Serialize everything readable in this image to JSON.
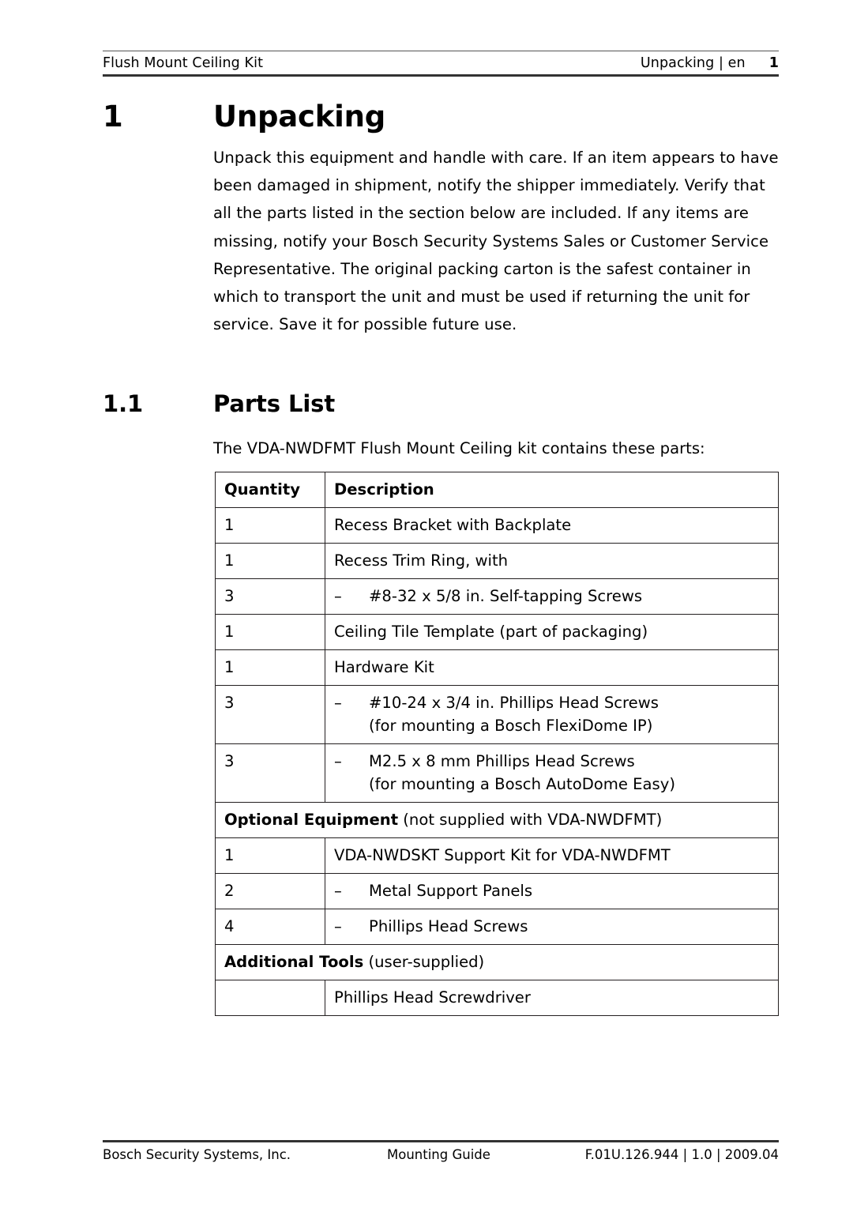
{
  "header": {
    "left": "Flush Mount Ceiling Kit",
    "chapter": "Unpacking | en",
    "page_number": "1"
  },
  "chapter": {
    "number": "1",
    "title": "Unpacking",
    "paragraph": "Unpack this equipment and handle with care. If an item appears to have been damaged in shipment, notify the shipper immediately. Verify that all the parts listed in the section below are included. If any items are missing, notify your Bosch Security Systems Sales or Customer Service Representative. The original packing carton is the safest container in which to transport the unit and must be used if returning the unit for service. Save it for possible future use."
  },
  "section": {
    "number": "1.1",
    "title": "Parts List",
    "intro": "The VDA-NWDFMT Flush Mount Ceiling kit contains these parts:"
  },
  "table": {
    "headers": {
      "quantity": "Quantity",
      "description": "Description"
    },
    "rows": [
      {
        "qty": "1",
        "desc": "Recess Bracket with Backplate"
      },
      {
        "qty": "1",
        "desc": "Recess Trim Ring, with"
      },
      {
        "qty": "3",
        "dash": "–",
        "desc": "#8-32 x 5/8 in. Self-tapping Screws"
      },
      {
        "qty": "1",
        "desc": "Ceiling Tile Template (part of packaging)"
      },
      {
        "qty": "1",
        "desc": "Hardware Kit"
      },
      {
        "qty": "3",
        "dash": "–",
        "desc": "#10-24 x 3/4 in. Phillips Head Screws",
        "note": "(for mounting a Bosch FlexiDome IP)"
      },
      {
        "qty": "3",
        "dash": "–",
        "desc": "M2.5 x 8 mm Phillips Head Screws",
        "note": "(for mounting a Bosch AutoDome Easy)"
      }
    ],
    "optional_section": {
      "title": "Optional Equipment",
      "suffix": " (not supplied with VDA-NWDFMT)"
    },
    "optional_rows": [
      {
        "qty": "1",
        "desc": "VDA-NWDSKT Support Kit for VDA-NWDFMT"
      },
      {
        "qty": "2",
        "dash": "–",
        "desc": "Metal Support Panels"
      },
      {
        "qty": "4",
        "dash": "–",
        "desc": "Phillips Head Screws"
      }
    ],
    "tools_section": {
      "title": "Additional Tools",
      "suffix": " (user-supplied)"
    },
    "tools_rows": [
      {
        "qty": "",
        "desc": "Phillips Head Screwdriver"
      }
    ]
  },
  "footer": {
    "left": "Bosch Security Systems, Inc.",
    "center": "Mounting Guide",
    "right": "F.01U.126.944 | 1.0 | 2009.04"
  }
}
